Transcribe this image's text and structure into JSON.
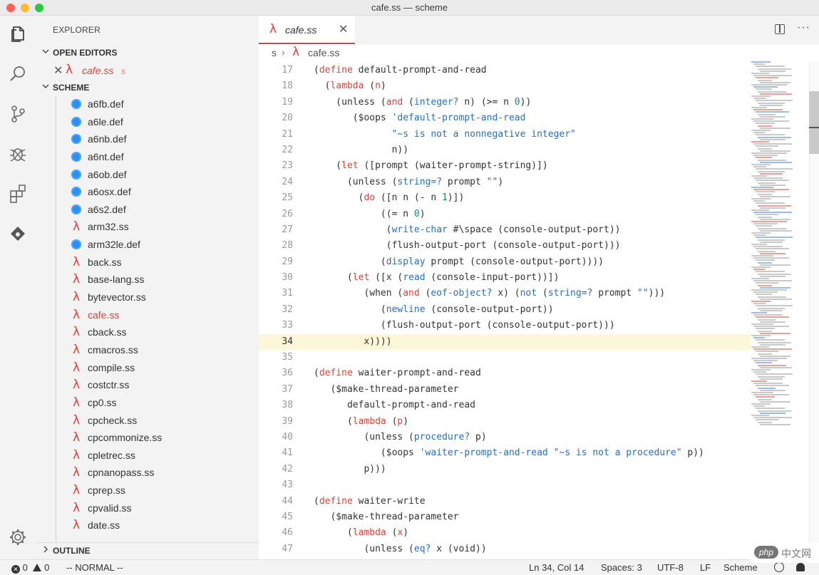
{
  "window": {
    "title": "cafe.ss — scheme"
  },
  "activity_bar": [
    {
      "name": "explorer-icon"
    },
    {
      "name": "search-icon"
    },
    {
      "name": "source-control-icon"
    },
    {
      "name": "debug-icon"
    },
    {
      "name": "extensions-icon"
    },
    {
      "name": "remote-icon"
    },
    {
      "name": "gear-icon"
    }
  ],
  "sidebar": {
    "header": "EXPLORER",
    "open_editors_label": "OPEN EDITORS",
    "open_editor": {
      "name": "cafe.ss",
      "dir": "s"
    },
    "folder_label": "SCHEME",
    "outline_label": "OUTLINE",
    "files": [
      {
        "name": "a6fb.def",
        "kind": "def"
      },
      {
        "name": "a6le.def",
        "kind": "def"
      },
      {
        "name": "a6nb.def",
        "kind": "def"
      },
      {
        "name": "a6nt.def",
        "kind": "def"
      },
      {
        "name": "a6ob.def",
        "kind": "def"
      },
      {
        "name": "a6osx.def",
        "kind": "def"
      },
      {
        "name": "a6s2.def",
        "kind": "def"
      },
      {
        "name": "arm32.ss",
        "kind": "ss"
      },
      {
        "name": "arm32le.def",
        "kind": "def"
      },
      {
        "name": "back.ss",
        "kind": "ss"
      },
      {
        "name": "base-lang.ss",
        "kind": "ss"
      },
      {
        "name": "bytevector.ss",
        "kind": "ss"
      },
      {
        "name": "cafe.ss",
        "kind": "ss",
        "active": true
      },
      {
        "name": "cback.ss",
        "kind": "ss"
      },
      {
        "name": "cmacros.ss",
        "kind": "ss"
      },
      {
        "name": "compile.ss",
        "kind": "ss"
      },
      {
        "name": "costctr.ss",
        "kind": "ss"
      },
      {
        "name": "cp0.ss",
        "kind": "ss"
      },
      {
        "name": "cpcheck.ss",
        "kind": "ss"
      },
      {
        "name": "cpcommonize.ss",
        "kind": "ss"
      },
      {
        "name": "cpletrec.ss",
        "kind": "ss"
      },
      {
        "name": "cpnanopass.ss",
        "kind": "ss"
      },
      {
        "name": "cprep.ss",
        "kind": "ss"
      },
      {
        "name": "cpvalid.ss",
        "kind": "ss"
      },
      {
        "name": "date.ss",
        "kind": "ss"
      }
    ]
  },
  "editor": {
    "tab": {
      "name": "cafe.ss"
    },
    "breadcrumb": {
      "folder": "s",
      "file": "cafe.ss"
    },
    "current_line": 34,
    "lines": [
      {
        "n": "17",
        "tokens": [
          [
            "p",
            "("
          ],
          [
            "kw",
            "define"
          ],
          [
            "p",
            " default-prompt-and-read"
          ]
        ]
      },
      {
        "n": "18",
        "tokens": [
          [
            "p",
            "  ("
          ],
          [
            "kw",
            "lambda"
          ],
          [
            "p",
            " ("
          ],
          [
            "kw",
            "n"
          ],
          [
            "p",
            ")"
          ]
        ]
      },
      {
        "n": "19",
        "tokens": [
          [
            "p",
            "    (unless ("
          ],
          [
            "kw",
            "and"
          ],
          [
            "p",
            " ("
          ],
          [
            "fn",
            "integer?"
          ],
          [
            "p",
            " n) (>= n "
          ],
          [
            "num",
            "0"
          ],
          [
            "p",
            "))"
          ]
        ]
      },
      {
        "n": "20",
        "tokens": [
          [
            "p",
            "       ($oops "
          ],
          [
            "str",
            "'default-prompt-and-read"
          ]
        ]
      },
      {
        "n": "21",
        "tokens": [
          [
            "str",
            "              \"~s is not a nonnegative integer\""
          ]
        ]
      },
      {
        "n": "22",
        "tokens": [
          [
            "p",
            "              n))"
          ]
        ]
      },
      {
        "n": "23",
        "tokens": [
          [
            "p",
            "    ("
          ],
          [
            "kw",
            "let"
          ],
          [
            "p",
            " ([prompt (waiter-prompt-string)])"
          ]
        ]
      },
      {
        "n": "24",
        "tokens": [
          [
            "p",
            "      (unless ("
          ],
          [
            "fn",
            "string=?"
          ],
          [
            "p",
            " prompt "
          ],
          [
            "str",
            "\"\""
          ],
          [
            "p",
            ")"
          ]
        ]
      },
      {
        "n": "25",
        "tokens": [
          [
            "p",
            "        ("
          ],
          [
            "kw",
            "do"
          ],
          [
            "p",
            " ([n n (- n "
          ],
          [
            "num",
            "1"
          ],
          [
            "p",
            ")])"
          ]
        ]
      },
      {
        "n": "26",
        "tokens": [
          [
            "p",
            "            ((= n "
          ],
          [
            "num",
            "0"
          ],
          [
            "p",
            ")"
          ]
        ]
      },
      {
        "n": "27",
        "tokens": [
          [
            "p",
            "             ("
          ],
          [
            "fn",
            "write-char"
          ],
          [
            "p",
            " #\\space (console-output-port))"
          ]
        ]
      },
      {
        "n": "28",
        "tokens": [
          [
            "p",
            "             (flush-output-port (console-output-port)))"
          ]
        ]
      },
      {
        "n": "29",
        "tokens": [
          [
            "p",
            "            ("
          ],
          [
            "fn",
            "display"
          ],
          [
            "p",
            " prompt (console-output-port))))"
          ]
        ]
      },
      {
        "n": "30",
        "tokens": [
          [
            "p",
            "      ("
          ],
          [
            "kw",
            "let"
          ],
          [
            "p",
            " ([x ("
          ],
          [
            "fn",
            "read"
          ],
          [
            "p",
            " (console-input-port))])"
          ]
        ]
      },
      {
        "n": "31",
        "tokens": [
          [
            "p",
            "         (when ("
          ],
          [
            "kw",
            "and"
          ],
          [
            "p",
            " ("
          ],
          [
            "fn",
            "eof-object?"
          ],
          [
            "p",
            " x) ("
          ],
          [
            "fn",
            "not"
          ],
          [
            "p",
            " ("
          ],
          [
            "fn",
            "string=?"
          ],
          [
            "p",
            " prompt "
          ],
          [
            "str",
            "\"\""
          ],
          [
            "p",
            ")))"
          ]
        ]
      },
      {
        "n": "32",
        "tokens": [
          [
            "p",
            "            ("
          ],
          [
            "fn",
            "newline"
          ],
          [
            "p",
            " (console-output-port))"
          ]
        ]
      },
      {
        "n": "33",
        "tokens": [
          [
            "p",
            "            (flush-output-port (console-output-port)))"
          ]
        ]
      },
      {
        "n": "34",
        "tokens": [
          [
            "p",
            "         x))))"
          ]
        ]
      },
      {
        "n": "35",
        "tokens": []
      },
      {
        "n": "36",
        "tokens": [
          [
            "p",
            "("
          ],
          [
            "kw",
            "define"
          ],
          [
            "p",
            " waiter-prompt-and-read"
          ]
        ]
      },
      {
        "n": "37",
        "tokens": [
          [
            "p",
            "   ($make-thread-parameter"
          ]
        ]
      },
      {
        "n": "38",
        "tokens": [
          [
            "p",
            "      default-prompt-and-read"
          ]
        ]
      },
      {
        "n": "39",
        "tokens": [
          [
            "p",
            "      ("
          ],
          [
            "kw",
            "lambda"
          ],
          [
            "p",
            " ("
          ],
          [
            "kw",
            "p"
          ],
          [
            "p",
            ")"
          ]
        ]
      },
      {
        "n": "40",
        "tokens": [
          [
            "p",
            "         (unless ("
          ],
          [
            "fn",
            "procedure?"
          ],
          [
            "p",
            " p)"
          ]
        ]
      },
      {
        "n": "41",
        "tokens": [
          [
            "p",
            "            ($oops "
          ],
          [
            "str",
            "'waiter-prompt-and-read"
          ],
          [
            "p",
            " "
          ],
          [
            "str",
            "\"~s is not a procedure\""
          ],
          [
            "p",
            " p))"
          ]
        ]
      },
      {
        "n": "42",
        "tokens": [
          [
            "p",
            "         p)))"
          ]
        ]
      },
      {
        "n": "43",
        "tokens": []
      },
      {
        "n": "44",
        "tokens": [
          [
            "p",
            "("
          ],
          [
            "kw",
            "define"
          ],
          [
            "p",
            " waiter-write"
          ]
        ]
      },
      {
        "n": "45",
        "tokens": [
          [
            "p",
            "   ($make-thread-parameter"
          ]
        ]
      },
      {
        "n": "46",
        "tokens": [
          [
            "p",
            "      ("
          ],
          [
            "kw",
            "lambda"
          ],
          [
            "p",
            " ("
          ],
          [
            "kw",
            "x"
          ],
          [
            "p",
            ")"
          ]
        ]
      },
      {
        "n": "47",
        "tokens": [
          [
            "p",
            "         (unless ("
          ],
          [
            "fn",
            "eq?"
          ],
          [
            "p",
            " x (void))"
          ]
        ]
      }
    ]
  },
  "status_bar": {
    "errors": "0",
    "warnings": "0",
    "mode": "-- NORMAL --",
    "position": "Ln 34, Col 14",
    "spaces": "Spaces: 3",
    "encoding": "UTF-8",
    "eol": "LF",
    "language": "Scheme"
  },
  "watermark": {
    "badge": "php",
    "text": "中文网"
  },
  "colors": {
    "accent": "#e0413a",
    "keyword": "#e0413a",
    "builtin": "#2a6ebd",
    "number": "#1a8c66",
    "current_line": "#fbf7d8"
  }
}
